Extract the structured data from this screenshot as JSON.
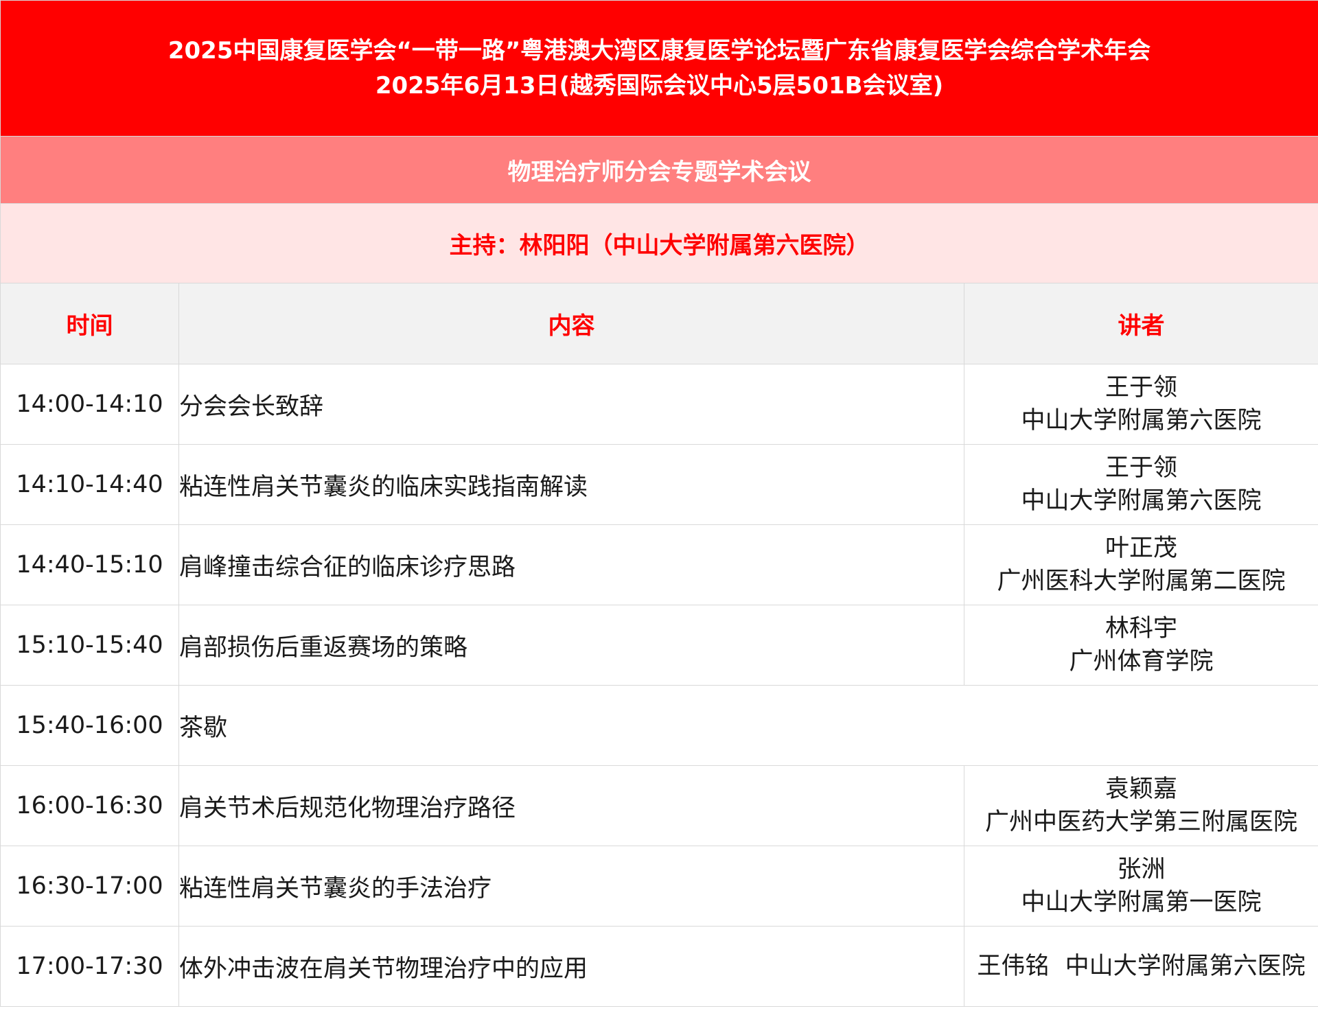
{
  "header": {
    "title_line1": "2025中国康复医学会“一带一路”粤港澳大湾区康复医学论坛暨广东省康复医学会综合学术年会",
    "title_line2": "2025年6月13日(越秀国际会议中心5层501B会议室)"
  },
  "session": {
    "name": "物理治疗师分会专题学术会议",
    "host": "主持：林阳阳（中山大学附属第六医院）"
  },
  "columns": {
    "time": "时间",
    "topic": "内容",
    "speaker": "讲者"
  },
  "rows": [
    {
      "time": "14:00-14:10",
      "topic": "分会会长致辞",
      "speaker": "王于领",
      "org": "中山大学附属第六医院"
    },
    {
      "time": "14:10-14:40",
      "topic": "粘连性肩关节囊炎的临床实践指南解读",
      "speaker": "王于领",
      "org": "中山大学附属第六医院"
    },
    {
      "time": "14:40-15:10",
      "topic": "肩峰撞击综合征的临床诊疗思路",
      "speaker": "叶正茂",
      "org": "广州医科大学附属第二医院"
    },
    {
      "time": "15:10-15:40",
      "topic": "肩部损伤后重返赛场的策略",
      "speaker": "林科宇",
      "org": "广州体育学院"
    },
    {
      "time": "15:40-16:00",
      "topic": "茶歇",
      "speaker": "",
      "org": ""
    },
    {
      "time": "16:00-16:30",
      "topic": "肩关节术后规范化物理治疗路径",
      "speaker": "袁颖嘉",
      "org": "广州中医药大学第三附属医院"
    },
    {
      "time": "16:30-17:00",
      "topic": "粘连性肩关节囊炎的手法治疗",
      "speaker": "张洲",
      "org": "中山大学附属第一医院"
    },
    {
      "time": "17:00-17:30",
      "topic": "体外冲击波在肩关节物理治疗中的应用",
      "speaker": "王伟铭",
      "org": "中山大学附属第六医院"
    }
  ],
  "colors": {
    "title_bg": "#ff0000",
    "session_bg": "#ff7f7f",
    "host_bg": "#ffe5e5",
    "header_bg": "#f2f2f2",
    "accent_text": "#ff0000"
  }
}
